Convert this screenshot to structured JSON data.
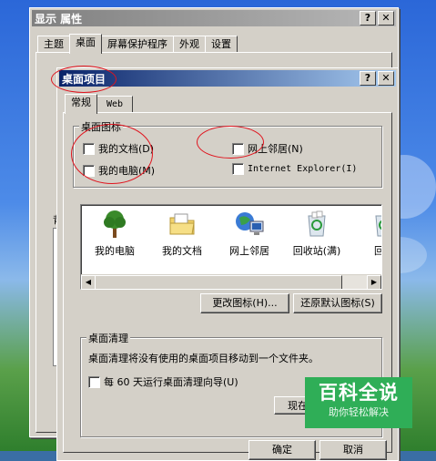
{
  "outer_window": {
    "title": "显示 属性",
    "help_btn": "?",
    "close_btn": "✕",
    "tabs": [
      "主题",
      "桌面",
      "屏幕保护程序",
      "外观",
      "设置"
    ],
    "hidden_label_fragment": "背"
  },
  "dialog": {
    "title": "桌面项目",
    "help_btn": "?",
    "close_btn": "✕",
    "tabs": [
      "常规",
      "Web"
    ],
    "desktop_icons_group": {
      "label": "桌面图标",
      "checkboxes": [
        {
          "label": "我的文档(D)",
          "checked": false
        },
        {
          "label": "网上邻居(N)",
          "checked": false
        },
        {
          "label": "我的电脑(M)",
          "checked": false
        },
        {
          "label": "Internet Explorer(I)",
          "checked": false
        }
      ]
    },
    "icon_list": [
      {
        "label": "我的电脑",
        "icon": "tree-icon"
      },
      {
        "label": "我的文档",
        "icon": "folder-icon"
      },
      {
        "label": "网上邻居",
        "icon": "network-icon"
      },
      {
        "label": "回收站(满)",
        "icon": "recycle-bin-full-icon"
      },
      {
        "label": "回收",
        "icon": "recycle-bin-icon"
      }
    ],
    "change_icon_button": "更改图标(H)...",
    "restore_default_button": "还原默认图标(S)",
    "cleanup_group": {
      "label": "桌面清理",
      "description": "桌面清理将没有使用的桌面项目移动到一个文件夹。",
      "checkbox_label": "每 60 天运行桌面清理向导(U)",
      "checkbox_checked": false,
      "clean_now_button": "现在清"
    },
    "ok_button": "确定",
    "cancel_button": "取消"
  },
  "watermark": {
    "title": "百科全说",
    "subtitle": "助你轻松解决"
  },
  "colors": {
    "active_title_start": "#0a246a",
    "active_title_end": "#a6caf0",
    "face": "#d4d0c8",
    "annotation_red": "#e0141e",
    "watermark_green": "#2fae57"
  }
}
